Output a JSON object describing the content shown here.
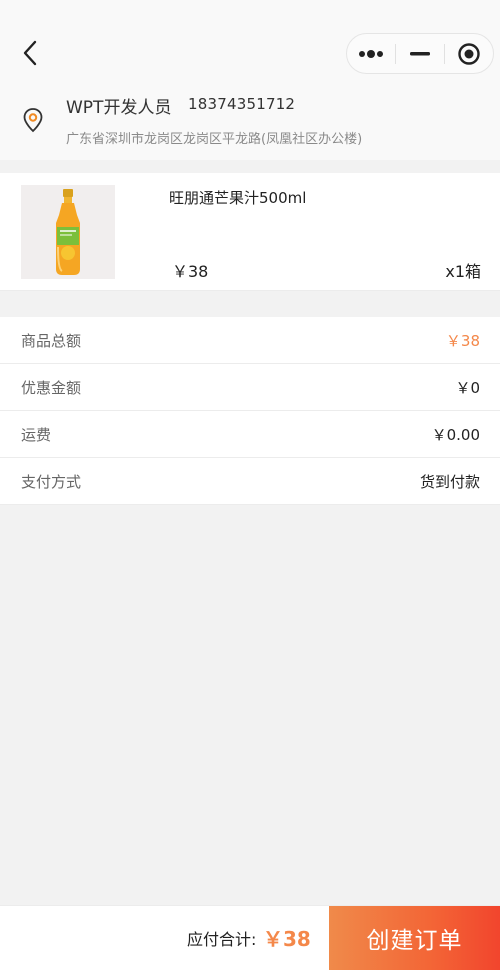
{
  "nav": {
    "back_icon": "chevron-left-icon",
    "menu_icons": [
      "more-dots-icon",
      "minimize-icon",
      "close-target-icon"
    ]
  },
  "address": {
    "name": "WPT开发人员",
    "phone": "18374351712",
    "detail": "广东省深圳市龙岗区龙岗区平龙路(凤凰社区办公楼)",
    "pin_color": "#f08a24"
  },
  "product": {
    "name": "旺朋通芒果汁500ml",
    "price": "￥38",
    "quantity": "x1箱"
  },
  "summary": {
    "rows": [
      {
        "label": "商品总额",
        "value": "￥38"
      },
      {
        "label": "优惠金额",
        "value": "￥0"
      },
      {
        "label": "运费",
        "value": "￥0.00"
      },
      {
        "label": "支付方式",
        "value": "货到付款"
      }
    ]
  },
  "footer": {
    "total_label": "应付合计:",
    "total_value": "￥38",
    "submit_label": "创建订单"
  },
  "colors": {
    "accent": "#f4884a",
    "submit_start": "#f08a4a",
    "submit_end": "#f2452d"
  }
}
